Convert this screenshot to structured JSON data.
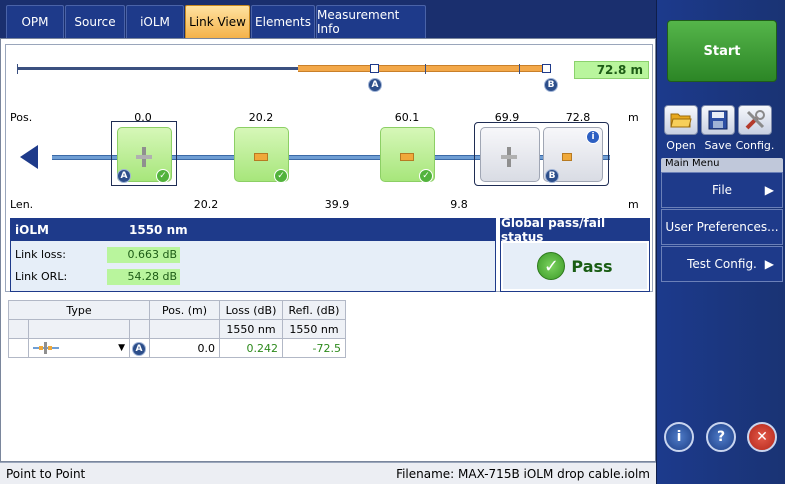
{
  "tabs": [
    {
      "label": "OPM",
      "active": false
    },
    {
      "label": "Source",
      "active": false
    },
    {
      "label": "iOLM",
      "active": false
    },
    {
      "label": "Link View",
      "active": true
    },
    {
      "label": "Elements",
      "active": false
    },
    {
      "label": "Measurement Info",
      "active": false
    }
  ],
  "link_view": {
    "total_distance": "72.8 m",
    "pos_label": "Pos.",
    "len_label": "Len.",
    "unit": "m",
    "marker_a": "A",
    "marker_b": "B",
    "positions": [
      "0.0",
      "20.2",
      "60.1",
      "69.9",
      "72.8"
    ],
    "lengths": [
      "20.2",
      "39.9",
      "9.8"
    ],
    "elements": [
      {
        "kind": "splice",
        "status": "pass",
        "marker": "A"
      },
      {
        "kind": "connector",
        "status": "pass"
      },
      {
        "kind": "connector",
        "status": "pass"
      },
      {
        "kind": "splice",
        "status": "none"
      },
      {
        "kind": "connector",
        "status": "info",
        "marker": "B"
      }
    ]
  },
  "iolm_summary": {
    "title": "iOLM",
    "wavelength": "1550 nm",
    "link_loss_label": "Link loss:",
    "link_loss_value": "0.663 dB",
    "link_orl_label": "Link ORL:",
    "link_orl_value": "54.28 dB"
  },
  "global_status": {
    "title": "Global pass/fail status",
    "result": "Pass"
  },
  "element_table": {
    "headers": [
      "Type",
      "Pos. (m)",
      "Loss (dB)",
      "Refl. (dB)"
    ],
    "subheaders": [
      "",
      "",
      "1550 nm",
      "1550 nm"
    ],
    "rows": [
      {
        "marker": "A",
        "pos": "0.0",
        "loss": "0.242",
        "refl": "-72.5"
      }
    ]
  },
  "sidebar": {
    "start_label": "Start",
    "tools": [
      {
        "label": "Open",
        "icon": "folder-open-icon"
      },
      {
        "label": "Save",
        "icon": "floppy-disk-icon"
      },
      {
        "label": "Config.",
        "icon": "tools-icon"
      }
    ],
    "menu_title": "Main Menu",
    "menu_items": [
      {
        "label": "File",
        "has_submenu": true
      },
      {
        "label": "User Preferences...",
        "has_submenu": false
      },
      {
        "label": "Test Config.",
        "has_submenu": true
      }
    ]
  },
  "status_bar": {
    "mode": "Point to Point",
    "filename": "Filename: MAX-715B iOLM drop cable.iolm"
  },
  "colors": {
    "accent_blue": "#1e3a8a",
    "pass_green": "#52b33c",
    "active_tab": "#f4b24a"
  }
}
